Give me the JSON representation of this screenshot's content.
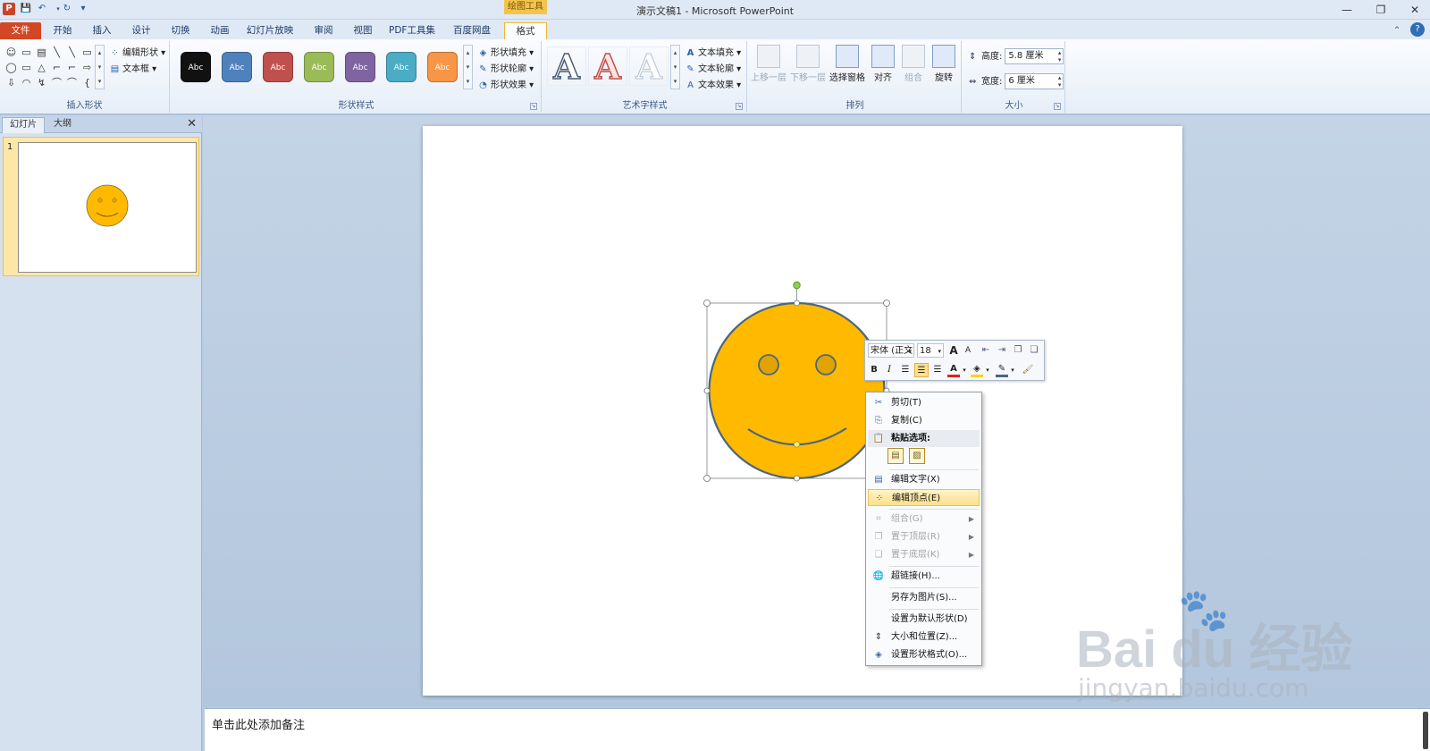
{
  "window": {
    "title": "演示文稿1 - Microsoft PowerPoint",
    "context_tab_label": "绘图工具",
    "minimize": "—",
    "restore": "❐",
    "close": "✕"
  },
  "quick_access": {
    "app_icon": "P",
    "save": "💾",
    "undo": "↶",
    "redo": "↻",
    "customize": "▾"
  },
  "tabs": [
    "文件",
    "开始",
    "插入",
    "设计",
    "切换",
    "动画",
    "幻灯片放映",
    "审阅",
    "视图",
    "PDF工具集",
    "百度网盘",
    "格式"
  ],
  "ribbon": {
    "insert_shapes": {
      "label": "插入形状",
      "edit_shape": "编辑形状",
      "text_box": "文本框",
      "shape_glyphs": [
        "☺",
        "▭",
        "▤",
        "╲",
        "╲",
        "▭",
        "◯",
        "▭",
        "△",
        "⌐",
        "⌐",
        "⇨",
        "⇩",
        "◠",
        "↯",
        "⌒",
        "⌒",
        "{"
      ]
    },
    "shape_styles": {
      "label": "形状样式",
      "swatch_text": "Abc",
      "fill": "形状填充",
      "outline": "形状轮廓",
      "effects": "形状效果",
      "colors": [
        "#111111",
        "#4f81bd",
        "#c0504d",
        "#9bbb59",
        "#8064a2",
        "#4bacc6",
        "#f79646"
      ]
    },
    "wordart_styles": {
      "label": "艺术字样式",
      "letter": "A",
      "text_fill": "文本填充",
      "text_outline": "文本轮廓",
      "text_effects": "文本效果"
    },
    "arrange": {
      "label": "排列",
      "bring_forward": "上移一层",
      "send_backward": "下移一层",
      "selection_pane": "选择窗格",
      "align": "对齐",
      "group": "组合",
      "rotate": "旋转"
    },
    "size": {
      "label": "大小",
      "height_label": "高度:",
      "height_value": "5.8 厘米",
      "width_label": "宽度:",
      "width_value": "6 厘米"
    }
  },
  "left_pane": {
    "tab_slides": "幻灯片",
    "tab_outline": "大纲",
    "close": "✕",
    "slide_number": "1"
  },
  "notes": {
    "placeholder": "单击此处添加备注"
  },
  "mini_toolbar": {
    "font": "宋体 (正文",
    "size": "18",
    "grow": "A",
    "shrink": "A",
    "bold": "B",
    "italic": "I",
    "font_color": "A"
  },
  "context_menu": {
    "cut": "剪切(T)",
    "copy": "复制(C)",
    "paste_options": "粘贴选项:",
    "edit_text": "编辑文字(X)",
    "edit_points": "编辑顶点(E)",
    "group": "组合(G)",
    "bring_to_front": "置于顶层(R)",
    "send_to_back": "置于底层(K)",
    "hyperlink": "超链接(H)...",
    "save_as_picture": "另存为图片(S)...",
    "set_default_shape": "设置为默认形状(D)",
    "size_position": "大小和位置(Z)...",
    "format_shape": "设置形状格式(O)..."
  },
  "watermark": {
    "logo": "Bai du 经验",
    "url": "jingyan.baidu.com"
  },
  "colors": {
    "smiley_fill": "#ffba00",
    "smiley_outline": "#4a6682",
    "file_tab": "#d24726",
    "highlight": "#fde08a"
  }
}
